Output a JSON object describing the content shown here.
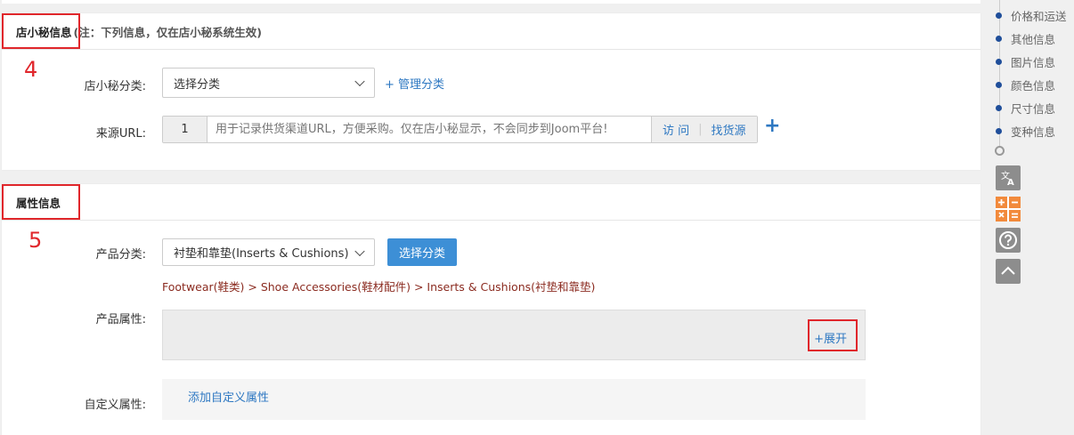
{
  "section_store": {
    "title": "店小秘信息",
    "note": "(注：下列信息，仅在店小秘系统生效)",
    "annotation_number": "4",
    "category_label": "店小秘分类:",
    "category_value": "选择分类",
    "manage_category_link": "+ 管理分类",
    "source_url_label": "来源URL:",
    "source_url_index": "1",
    "source_url_placeholder": "用于记录供货渠道URL，方便采购。仅在店小秘显示，不会同步到Joom平台!",
    "visit_label": "访 问",
    "separator": "|",
    "find_source_label": "找货源",
    "add_url_label": "+"
  },
  "section_attr": {
    "title": "属性信息",
    "annotation_number": "5",
    "product_category_label": "产品分类:",
    "product_category_value": "衬垫和靠垫(Inserts & Cushions)",
    "choose_category_button": "选择分类",
    "category_path": "Footwear(鞋类) > Shoe Accessories(鞋材配件) > Inserts & Cushions(衬垫和靠垫)",
    "product_attr_label": "产品属性:",
    "expand_link": "+展开",
    "custom_attr_label": "自定义属性:",
    "add_custom_attr_link": "添加自定义属性"
  },
  "side_nav": {
    "items": [
      "价格和运送",
      "其他信息",
      "图片信息",
      "颜色信息",
      "尺寸信息",
      "变种信息"
    ]
  },
  "tools": [
    "translate-icon",
    "calculator-icon",
    "help-icon",
    "back-to-top-icon"
  ],
  "colors": {
    "annotation_red": "#e0262b",
    "link_blue": "#2e78c2",
    "button_blue": "#3d8fd6",
    "path_brown": "#8b2b20",
    "nav_dot": "#1f4e9a",
    "calculator_orange": "#f28a3c"
  }
}
